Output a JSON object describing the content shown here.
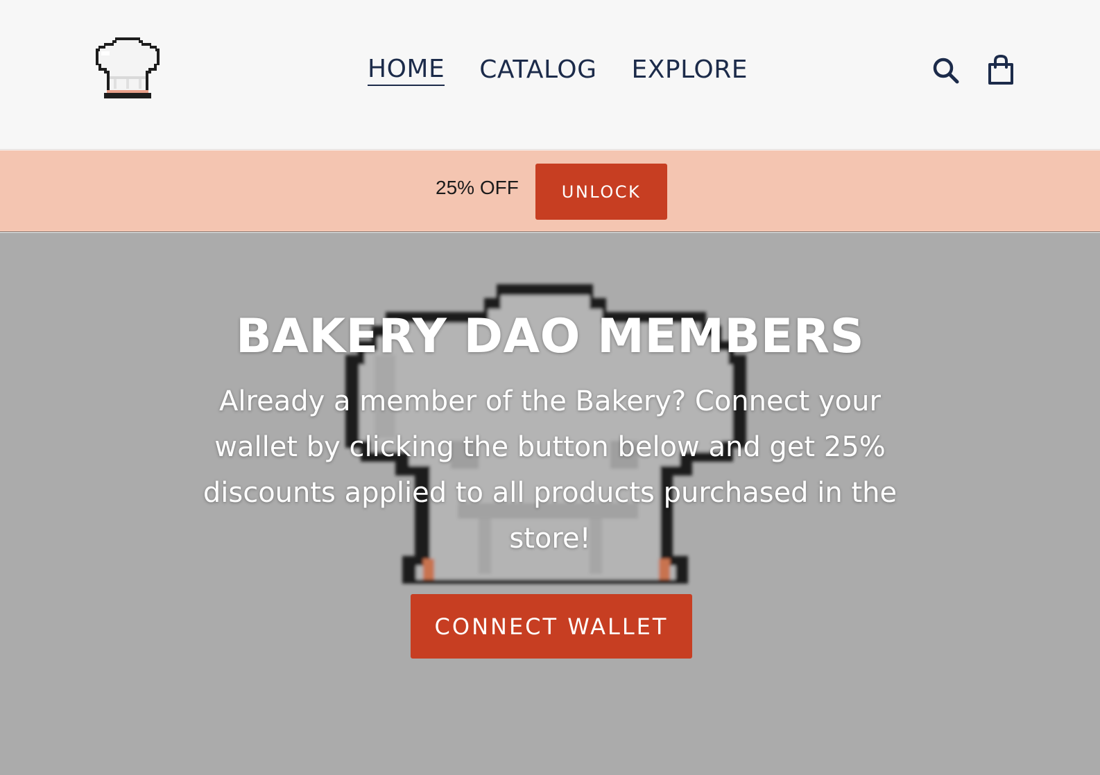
{
  "header": {
    "logo_name": "chef-hat-logo",
    "nav": [
      {
        "label": "HOME",
        "active": true
      },
      {
        "label": "CATALOG",
        "active": false
      },
      {
        "label": "EXPLORE",
        "active": false
      }
    ],
    "search_icon": "search-icon",
    "cart_icon": "shopping-bag-icon"
  },
  "promo": {
    "text": "25% OFF",
    "button_label": "UNLOCK"
  },
  "hero": {
    "title": "BAKERY DAO MEMBERS",
    "description": "Already a member of the Bakery? Connect your wallet by clicking the button below and get 25% discounts applied to all products purchased in the store!",
    "button_label": "CONNECT WALLET",
    "background_icon": "chef-hat-pixel-art"
  },
  "colors": {
    "navy": "#1c2b4a",
    "accent": "#c73e22",
    "promo_bg": "#f4c5b1",
    "hero_bg": "#ababab",
    "header_bg": "#f7f7f7"
  }
}
